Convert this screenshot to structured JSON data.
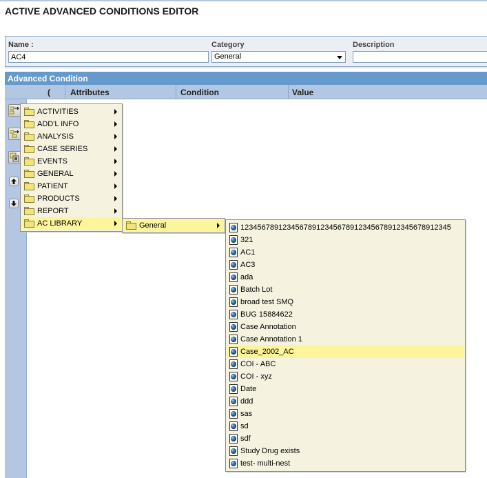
{
  "page": {
    "title": "ACTIVE ADVANCED CONDITIONS EDITOR"
  },
  "form": {
    "name_label": "Name :",
    "name_value": "AC4",
    "category_label": "Category",
    "category_value": "General",
    "description_label": "Description",
    "description_value": ""
  },
  "grid": {
    "header": "Advanced Condition",
    "columns": [
      "(",
      "Attributes",
      "Condition",
      "Value"
    ]
  },
  "toolbar": {
    "buttons": [
      {
        "name": "add-condition-icon"
      },
      {
        "name": "add-group-icon"
      },
      {
        "name": "library-icon"
      },
      {
        "name": "move-up-icon"
      },
      {
        "name": "move-down-icon"
      }
    ]
  },
  "menus": {
    "attribute_categories": [
      {
        "label": "ACTIVITIES"
      },
      {
        "label": "ADD'L INFO"
      },
      {
        "label": "ANALYSIS"
      },
      {
        "label": "CASE SERIES"
      },
      {
        "label": "EVENTS"
      },
      {
        "label": "GENERAL"
      },
      {
        "label": "PATIENT"
      },
      {
        "label": "PRODUCTS"
      },
      {
        "label": "REPORT"
      },
      {
        "label": "AC LIBRARY",
        "highlighted": true
      }
    ],
    "ac_library": [
      {
        "label": "General",
        "highlighted": true
      }
    ],
    "general_conditions": [
      {
        "label": "12345678912345678912345678912345678912345678912345"
      },
      {
        "label": "321"
      },
      {
        "label": "AC1"
      },
      {
        "label": "AC3"
      },
      {
        "label": "ada"
      },
      {
        "label": "Batch Lot"
      },
      {
        "label": "broad test SMQ"
      },
      {
        "label": "BUG 15884622"
      },
      {
        "label": "Case Annotation"
      },
      {
        "label": "Case Annotation 1"
      },
      {
        "label": "Case_2002_AC",
        "highlighted": true
      },
      {
        "label": "COI - ABC"
      },
      {
        "label": "COI - xyz"
      },
      {
        "label": "Date"
      },
      {
        "label": "ddd"
      },
      {
        "label": "sas"
      },
      {
        "label": "sd"
      },
      {
        "label": "sdf"
      },
      {
        "label": "Study Drug exists"
      },
      {
        "label": "test- multi-nest"
      }
    ]
  },
  "colors": {
    "header_blue": "#6699cc",
    "column_header": "#b3c7e2",
    "menu_bg": "#f5f3e0",
    "menu_highlight": "#fbf59b"
  }
}
